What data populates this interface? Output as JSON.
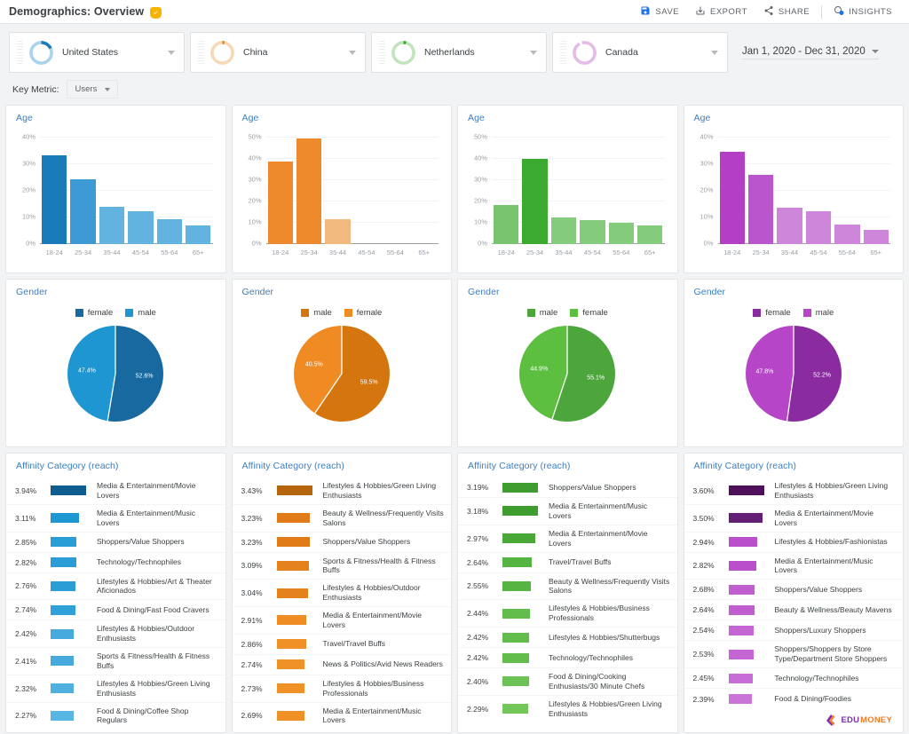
{
  "header": {
    "title": "Demographics: Overview",
    "badge_icon": "verified-shield-icon",
    "actions": [
      {
        "label": "SAVE",
        "icon": "save-icon"
      },
      {
        "label": "EXPORT",
        "icon": "export-icon"
      },
      {
        "label": "SHARE",
        "icon": "share-icon"
      },
      {
        "label": "INSIGHTS",
        "icon": "insights-icon"
      }
    ]
  },
  "segments": [
    {
      "label": "United States",
      "color": "#1a7bb9",
      "ring_light": "#a9d4ec"
    },
    {
      "label": "China",
      "color": "#e07b18",
      "ring_light": "#f6d9b8"
    },
    {
      "label": "Netherlands",
      "color": "#3aab38",
      "ring_light": "#c3e3bf"
    },
    {
      "label": "Canada",
      "color": "#a336b0",
      "ring_light": "#e3bde6"
    }
  ],
  "date_range": {
    "label": "Jan 1, 2020 - Dec 31, 2020"
  },
  "key_metric": {
    "label": "Key Metric:",
    "value": "Users"
  },
  "card_titles": {
    "age": "Age",
    "gender": "Gender",
    "affinity": "Affinity Category (reach)"
  },
  "chart_data": [
    {
      "type": "bar",
      "title": "Age",
      "segment": "United States",
      "categories": [
        "18-24",
        "25-34",
        "35-44",
        "45-54",
        "55-64",
        "65+"
      ],
      "values": [
        33.5,
        24.5,
        14.0,
        12.3,
        9.2,
        7.0
      ],
      "ylim": [
        0,
        40
      ],
      "yticks": [
        0,
        10,
        20,
        30,
        40
      ],
      "ytick_labels": [
        "0%",
        "10%",
        "20%",
        "30%",
        "40%"
      ],
      "xlabel": "",
      "ylabel": "",
      "colors": {
        "primary": "#1a7bb9",
        "secondary": "#3d9ad4",
        "tertiary": "#62b3e0"
      },
      "bar_colors": [
        "#1a7bb9",
        "#3d9ad4",
        "#62b3e0",
        "#62b3e0",
        "#62b3e0",
        "#62b3e0"
      ]
    },
    {
      "type": "bar",
      "title": "Age",
      "segment": "China",
      "categories": [
        "18-24",
        "25-34",
        "35-44",
        "45-54",
        "55-64",
        "65+"
      ],
      "values": [
        38.7,
        49.5,
        11.5,
        0,
        0,
        0
      ],
      "ylim": [
        0,
        50
      ],
      "yticks": [
        0,
        10,
        20,
        30,
        40,
        50
      ],
      "ytick_labels": [
        "0%",
        "10%",
        "20%",
        "30%",
        "40%",
        "50%"
      ],
      "xlabel": "",
      "ylabel": "",
      "bar_colors": [
        "#ef8a2c",
        "#ef8a2c",
        "#f2b97e",
        "#f2b97e",
        "#f2b97e",
        "#f2b97e"
      ]
    },
    {
      "type": "bar",
      "title": "Age",
      "segment": "Netherlands",
      "categories": [
        "18-24",
        "25-34",
        "35-44",
        "45-54",
        "55-64",
        "65+"
      ],
      "values": [
        18.3,
        40.0,
        12.5,
        11.2,
        10.0,
        8.7
      ],
      "ylim": [
        0,
        50
      ],
      "yticks": [
        0,
        10,
        20,
        30,
        40,
        50
      ],
      "ytick_labels": [
        "0%",
        "10%",
        "20%",
        "30%",
        "40%",
        "50%"
      ],
      "xlabel": "",
      "ylabel": "",
      "bar_colors": [
        "#78c46f",
        "#3aab2f",
        "#85cb7c",
        "#85cb7c",
        "#85cb7c",
        "#85cb7c"
      ]
    },
    {
      "type": "bar",
      "title": "Age",
      "segment": "Canada",
      "categories": [
        "18-24",
        "25-34",
        "35-44",
        "45-54",
        "55-64",
        "65+"
      ],
      "values": [
        34.7,
        26.0,
        13.7,
        12.3,
        7.5,
        5.2
      ],
      "ylim": [
        0,
        40
      ],
      "yticks": [
        0,
        10,
        20,
        30,
        40
      ],
      "ytick_labels": [
        "0%",
        "10%",
        "20%",
        "30%",
        "40%"
      ],
      "xlabel": "",
      "ylabel": "",
      "bar_colors": [
        "#b43ec4",
        "#bb55cb",
        "#ce86da",
        "#ce86da",
        "#ce86da",
        "#ce86da"
      ]
    },
    {
      "type": "pie",
      "title": "Gender",
      "segment": "United States",
      "labels": [
        "female",
        "male"
      ],
      "values": [
        52.6,
        47.4
      ],
      "value_labels": [
        "52.6%",
        "47.4%"
      ],
      "colors": [
        "#17699f",
        "#1e96d2"
      ],
      "legend_position": "top"
    },
    {
      "type": "pie",
      "title": "Gender",
      "segment": "China",
      "labels": [
        "male",
        "female"
      ],
      "values": [
        59.5,
        40.5
      ],
      "value_labels": [
        "59.5%",
        "40.5%"
      ],
      "colors": [
        "#d4750e",
        "#f08b23"
      ],
      "legend_position": "top"
    },
    {
      "type": "pie",
      "title": "Gender",
      "segment": "Netherlands",
      "labels": [
        "male",
        "female"
      ],
      "values": [
        55.1,
        44.9
      ],
      "value_labels": [
        "55.1%",
        "44.9%"
      ],
      "colors": [
        "#4ca63c",
        "#5cbf3f"
      ],
      "legend_position": "top"
    },
    {
      "type": "pie",
      "title": "Gender",
      "segment": "Canada",
      "labels": [
        "female",
        "male"
      ],
      "values": [
        52.2,
        47.8
      ],
      "value_labels": [
        "52.2%",
        "47.8%"
      ],
      "colors": [
        "#8a2ba0",
        "#b645c8"
      ],
      "legend_position": "top"
    },
    {
      "type": "bar",
      "title": "Affinity Category (reach)",
      "segment": "United States",
      "orientation": "horizontal",
      "categories": [
        "Media & Entertainment/Movie Lovers",
        "Media & Entertainment/Music Lovers",
        "Shoppers/Value Shoppers",
        "Technology/Technophiles",
        "Lifestyles & Hobbies/Art & Theater Aficionados",
        "Food & Dining/Fast Food Cravers",
        "Lifestyles & Hobbies/Outdoor Enthusiasts",
        "Sports & Fitness/Health & Fitness Buffs",
        "Lifestyles & Hobbies/Green Living Enthusiasts",
        "Food & Dining/Coffee Shop Regulars"
      ],
      "values": [
        3.94,
        3.11,
        2.85,
        2.82,
        2.76,
        2.74,
        2.42,
        2.41,
        2.32,
        2.27
      ],
      "value_labels": [
        "3.94%",
        "3.11%",
        "2.85%",
        "2.82%",
        "2.76%",
        "2.74%",
        "2.42%",
        "2.41%",
        "2.32%",
        "2.27%"
      ],
      "bar_colors": [
        "#0f5d8f",
        "#1e96d2",
        "#2a9cd6",
        "#2a9cd6",
        "#2a9cd6",
        "#2fa0d8",
        "#46aadd",
        "#46aadd",
        "#4fb0e0",
        "#58b6e3"
      ]
    },
    {
      "type": "bar",
      "title": "Affinity Category (reach)",
      "segment": "China",
      "orientation": "horizontal",
      "categories": [
        "Lifestyles & Hobbies/Green Living Enthusiasts",
        "Beauty & Wellness/Frequently Visits Salons",
        "Shoppers/Value Shoppers",
        "Sports & Fitness/Health & Fitness Buffs",
        "Lifestyles & Hobbies/Outdoor Enthusiasts",
        "Media & Entertainment/Movie Lovers",
        "Travel/Travel Buffs",
        "News & Politics/Avid News Readers",
        "Lifestyles & Hobbies/Business Professionals",
        "Media & Entertainment/Music Lovers"
      ],
      "values": [
        3.43,
        3.23,
        3.23,
        3.09,
        3.04,
        2.91,
        2.86,
        2.74,
        2.73,
        2.69
      ],
      "value_labels": [
        "3.43%",
        "3.23%",
        "3.23%",
        "3.09%",
        "3.04%",
        "2.91%",
        "2.86%",
        "2.74%",
        "2.73%",
        "2.69%"
      ],
      "bar_colors": [
        "#b5650d",
        "#e07b18",
        "#e07b18",
        "#e4821c",
        "#e4821c",
        "#ef8c24",
        "#f09127",
        "#f09127",
        "#f09127",
        "#f09127"
      ]
    },
    {
      "type": "bar",
      "title": "Affinity Category (reach)",
      "segment": "Netherlands",
      "orientation": "horizontal",
      "categories": [
        "Shoppers/Value Shoppers",
        "Media & Entertainment/Music Lovers",
        "Media & Entertainment/Movie Lovers",
        "Travel/Travel Buffs",
        "Beauty & Wellness/Frequently Visits Salons",
        "Lifestyles & Hobbies/Business Professionals",
        "Lifestyles & Hobbies/Shutterbugs",
        "Technology/Technophiles",
        "Food & Dining/Cooking Enthusiasts/30 Minute Chefs",
        "Lifestyles & Hobbies/Green Living Enthusiasts"
      ],
      "values": [
        3.19,
        3.18,
        2.97,
        2.64,
        2.55,
        2.44,
        2.42,
        2.42,
        2.4,
        2.29
      ],
      "value_labels": [
        "3.19%",
        "3.18%",
        "2.97%",
        "2.64%",
        "2.55%",
        "2.44%",
        "2.42%",
        "2.42%",
        "2.40%",
        "2.29%"
      ],
      "bar_colors": [
        "#3f9c2e",
        "#3f9c2e",
        "#4aa838",
        "#56b442",
        "#56b442",
        "#63bd4c",
        "#63bd4c",
        "#63bd4c",
        "#6cc254",
        "#72c65a"
      ]
    },
    {
      "type": "bar",
      "title": "Affinity Category (reach)",
      "segment": "Canada",
      "orientation": "horizontal",
      "categories": [
        "Lifestyles & Hobbies/Green Living Enthusiasts",
        "Media & Entertainment/Movie Lovers",
        "Lifestyles & Hobbies/Fashionistas",
        "Media & Entertainment/Music Lovers",
        "Shoppers/Value Shoppers",
        "Beauty & Wellness/Beauty Mavens",
        "Shoppers/Luxury Shoppers",
        "Shoppers/Shoppers by Store Type/Department Store Shoppers",
        "Technology/Technophiles",
        "Food & Dining/Foodies"
      ],
      "values": [
        3.6,
        3.5,
        2.94,
        2.82,
        2.68,
        2.64,
        2.54,
        2.53,
        2.45,
        2.39
      ],
      "value_labels": [
        "3.60%",
        "3.50%",
        "2.94%",
        "2.82%",
        "2.68%",
        "2.64%",
        "2.54%",
        "2.53%",
        "2.45%",
        "2.39%"
      ],
      "bar_colors": [
        "#4e1159",
        "#631f73",
        "#ba4fcb",
        "#ba4fcb",
        "#c05ed0",
        "#c05ed0",
        "#c366d3",
        "#c366d3",
        "#c76dd6",
        "#ca74d8"
      ]
    }
  ],
  "logo": {
    "text_primary": "EDU",
    "text_secondary": "MONEY"
  }
}
